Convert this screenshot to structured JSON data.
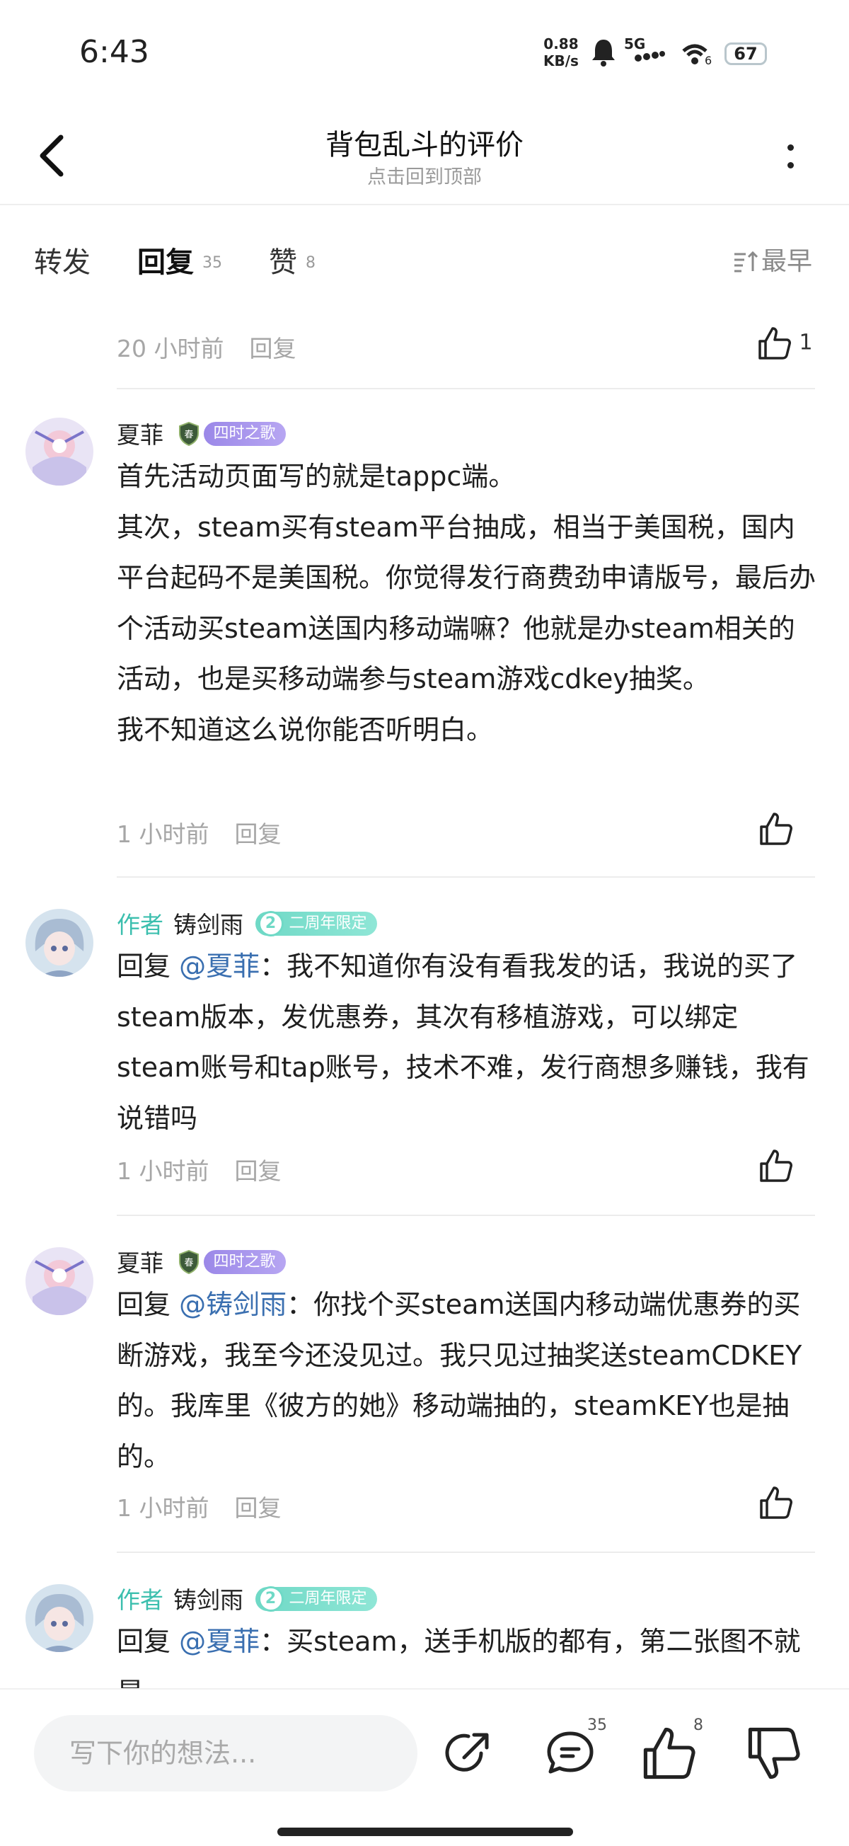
{
  "status_bar": {
    "time": "6:43",
    "net_speed_value": "0.88",
    "net_speed_unit": "KB/s",
    "network": "5G",
    "wifi_sub": "6",
    "battery": "67"
  },
  "nav": {
    "title": "背包乱斗的评价",
    "subtitle": "点击回到顶部"
  },
  "tabs": [
    {
      "label": "转发",
      "count": ""
    },
    {
      "label": "回复",
      "count": "35"
    },
    {
      "label": "赞",
      "count": "8"
    }
  ],
  "sort_label": "最早",
  "reply_label": "回复",
  "top_row": {
    "time": "20 小时前",
    "likes": "1"
  },
  "comments": [
    {
      "user": "夏菲",
      "author_tag": "",
      "badge": "四时之歌",
      "badge_icon": "shield-icon",
      "paragraphs": [
        "首先活动页面写的就是tappc端。",
        "其次，steam买有steam平台抽成，相当于美国税，国内平台起码不是美国税。你觉得发行商费劲申请版号，最后办个活动买steam送国内移动端嘛？他就是办steam相关的活动，也是买移动端参与steam游戏cdkey抽奖。",
        "我不知道这么说你能否听明白。"
      ],
      "time": "1 小时前"
    },
    {
      "user": "铸剑雨",
      "author_tag": "作者",
      "badge": "二周年限定",
      "badge_number": "2",
      "reply_prefix": "回复 ",
      "mention": "@夏菲",
      "text": "：我不知道你有没有看我发的话，我说的买了steam版本，发优惠券，其次有移植游戏，可以绑定steam账号和tap账号，技术不难，发行商想多赚钱，我有说错吗",
      "time": "1 小时前"
    },
    {
      "user": "夏菲",
      "author_tag": "",
      "badge": "四时之歌",
      "reply_prefix": "回复 ",
      "mention": "@铸剑雨",
      "text": "：你找个买steam送国内移动端优惠券的买断游戏，我至今还没见过。我只见过抽奖送steamCDKEY的。我库里《彼方的她》移动端抽的，steamKEY也是抽的。",
      "time": "1 小时前"
    },
    {
      "user": "铸剑雨",
      "author_tag": "作者",
      "badge": "二周年限定",
      "badge_number": "2",
      "reply_prefix": "回复 ",
      "mention": "@夏菲",
      "text": "：买steam，送手机版的都有，第二张图不就是"
    }
  ],
  "bottom_bar": {
    "placeholder": "写下你的想法...",
    "comment_count": "35",
    "like_count": "8"
  },
  "colors": {
    "accent": "#3cc9b4",
    "mention": "#3a6fb0",
    "badge_purple": "#a393ec",
    "badge_teal": "#7fdfcd"
  }
}
